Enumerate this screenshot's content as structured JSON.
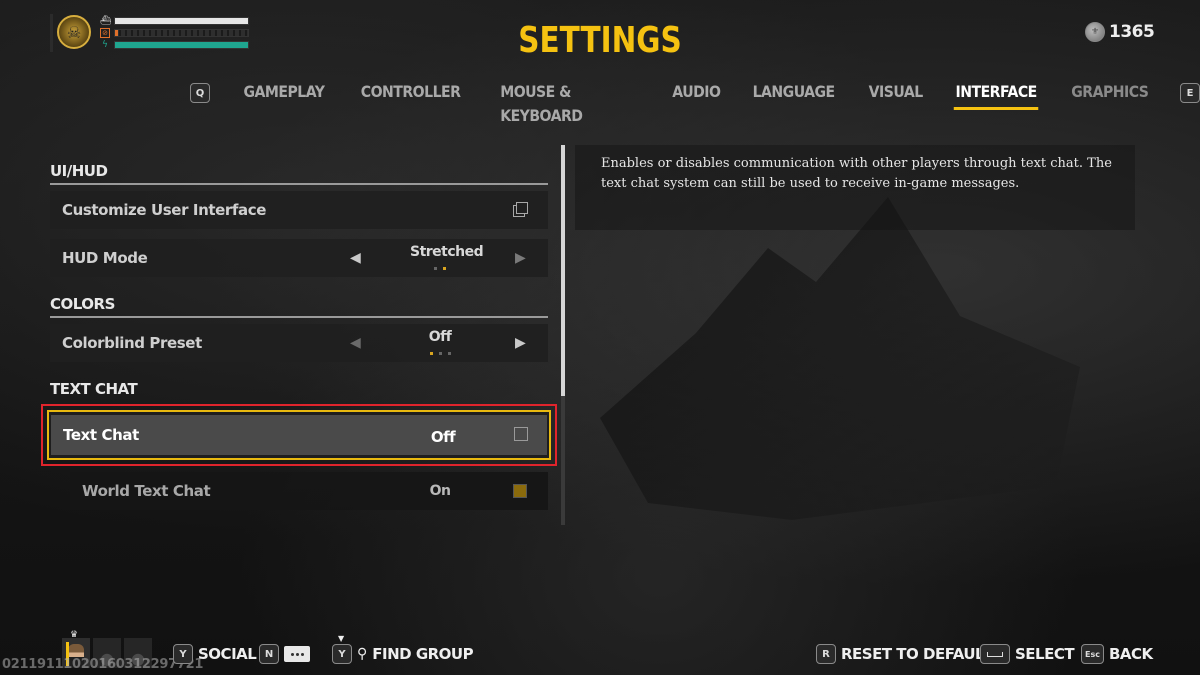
{
  "header": {
    "title": "SETTINGS",
    "currency": {
      "icon": "coin-icon",
      "value": "1365"
    },
    "player_status": {
      "emblem_icon": "skull-emblem-icon",
      "bars": [
        {
          "name": "hull",
          "icon": "ship-icon",
          "fill": 1.0,
          "color": "#e6e6e6"
        },
        {
          "name": "repair",
          "icon": "repair-icon",
          "fill": 0.02,
          "color": "#e0702a"
        },
        {
          "name": "energy",
          "icon": "lightning-icon",
          "fill": 1.0,
          "color": "#1fa58f"
        }
      ]
    }
  },
  "tabs": {
    "prev_key": "Q",
    "next_key": "E",
    "items": [
      {
        "label": "GAMEPLAY",
        "active": false
      },
      {
        "label": "CONTROLLER",
        "active": false
      },
      {
        "label": "MOUSE & KEYBOARD",
        "active": false
      },
      {
        "label": "AUDIO",
        "active": false
      },
      {
        "label": "LANGUAGE",
        "active": false
      },
      {
        "label": "VISUAL",
        "active": false
      },
      {
        "label": "INTERFACE",
        "active": true
      },
      {
        "label": "GRAPHICS",
        "active": false
      }
    ]
  },
  "sections": {
    "ui_hud": {
      "title": "UI/HUD",
      "customize": {
        "label": "Customize User Interface",
        "icon": "external-window-icon"
      },
      "hud_mode": {
        "label": "HUD Mode",
        "value": "Stretched",
        "option_count": 2,
        "selected_index": 1
      }
    },
    "colors": {
      "title": "COLORS",
      "colorblind": {
        "label": "Colorblind Preset",
        "value": "Off",
        "option_count": 3,
        "selected_index": 0
      }
    },
    "text_chat": {
      "title": "TEXT CHAT",
      "text_chat": {
        "label": "Text Chat",
        "value": "Off",
        "checked": false
      },
      "world_text_chat": {
        "label": "World Text Chat",
        "value": "On",
        "checked": true
      }
    }
  },
  "scrollbar": {
    "visible_fraction": 0.66,
    "position": 0.0
  },
  "description": {
    "text": "Enables or disables communication with other players through text chat. The text chat system can still be used to receive in-game messages."
  },
  "footer": {
    "session_id": "02119111020160312297721",
    "party_slots": [
      {
        "type": "self",
        "leader": true
      },
      {
        "type": "empty"
      },
      {
        "type": "empty"
      }
    ],
    "left_hints": [
      {
        "key": "Y",
        "label": "SOCIAL"
      },
      {
        "key": "N",
        "label": "",
        "icon": "chat-bubble-icon"
      },
      {
        "key": "Y",
        "label": "FIND GROUP",
        "icon": "find-group-icon"
      }
    ],
    "right_hints": [
      {
        "key": "R",
        "label": "RESET TO DEFAULT"
      },
      {
        "key": "Space",
        "label": "SELECT"
      },
      {
        "key": "Esc",
        "label": "BACK"
      }
    ]
  },
  "colors": {
    "accent": "#f5c211",
    "selection_outline": "#e0242c",
    "checkbox_on": "#8a6a0c"
  }
}
